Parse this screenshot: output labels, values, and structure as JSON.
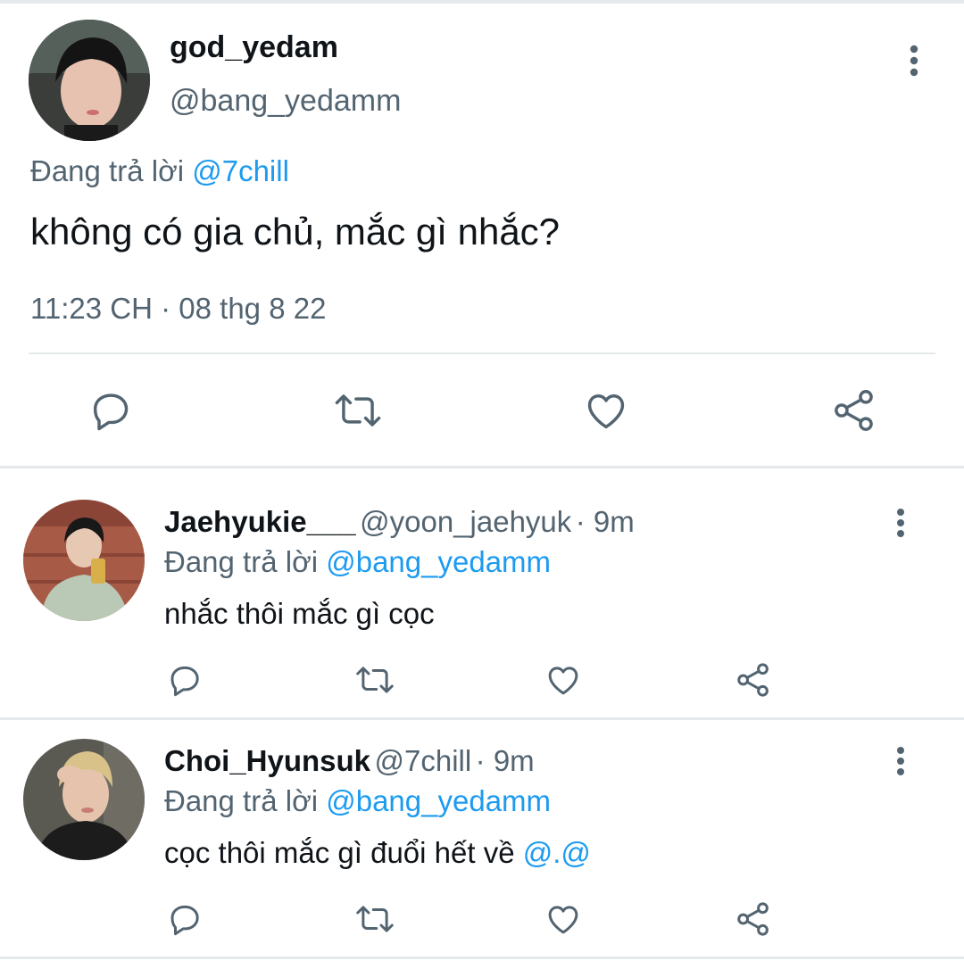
{
  "main_tweet": {
    "display_name": "god_yedam",
    "handle": "@bang_yedamm",
    "replying_prefix": "Đang trả lời",
    "replying_to": "@7chill",
    "text": "không có gia chủ, mắc gì nhắc?",
    "timestamp": "11:23 CH · 08 thg 8 22",
    "actions": [
      "reply-icon",
      "retweet-icon",
      "like-icon",
      "share-icon"
    ]
  },
  "replies": [
    {
      "display_name": "Jaehyukie___",
      "handle": "@yoon_jaehyuk",
      "time": "· 9m",
      "replying_prefix": "Đang trả lời",
      "replying_to": "@bang_yedamm",
      "text": "nhắc thôi mắc gì cọc",
      "text_mention": ""
    },
    {
      "display_name": "Choi_Hyunsuk",
      "handle": "@7chill",
      "time": "· 9m",
      "replying_prefix": "Đang trả lời",
      "replying_to": "@bang_yedamm",
      "text": "cọc thôi mắc gì đuổi hết về ",
      "text_mention": "@.@"
    }
  ],
  "colors": {
    "text": "#0f1419",
    "secondary": "#536471",
    "link": "#1d9bf0",
    "divider": "#e6e9ec",
    "icon": "#536471"
  }
}
